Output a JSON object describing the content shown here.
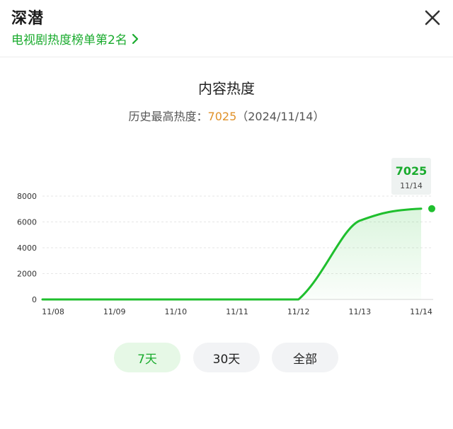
{
  "header": {
    "title": "深潜",
    "rank_text": "电视剧热度榜单第2名",
    "icons": {
      "rank": "chevron-right-icon",
      "close": "close-icon"
    }
  },
  "panel": {
    "title": "内容热度",
    "max_label": "历史最高热度：",
    "max_value": "7025",
    "max_date": "（2024/11/14）"
  },
  "colors": {
    "accent": "#1aab2e",
    "line": "#1fbf2e",
    "highlight": "#e0922a",
    "tooltip_bg": "#eef2f1"
  },
  "chart_data": {
    "type": "area",
    "x": [
      "11/08",
      "11/09",
      "11/10",
      "11/11",
      "11/12",
      "11/13",
      "11/14"
    ],
    "series": [
      {
        "values": [
          0,
          0,
          0,
          0,
          0,
          6100,
          7025
        ]
      }
    ],
    "yticks": [
      "0",
      "2000",
      "4000",
      "6000",
      "8000"
    ],
    "ylim": [
      0,
      8000
    ],
    "grid": true,
    "legend": "none",
    "annotation": {
      "value": "7025",
      "date": "11/14"
    }
  },
  "ranges": [
    {
      "label": "7天",
      "active": true
    },
    {
      "label": "30天",
      "active": false
    },
    {
      "label": "全部",
      "active": false
    }
  ]
}
